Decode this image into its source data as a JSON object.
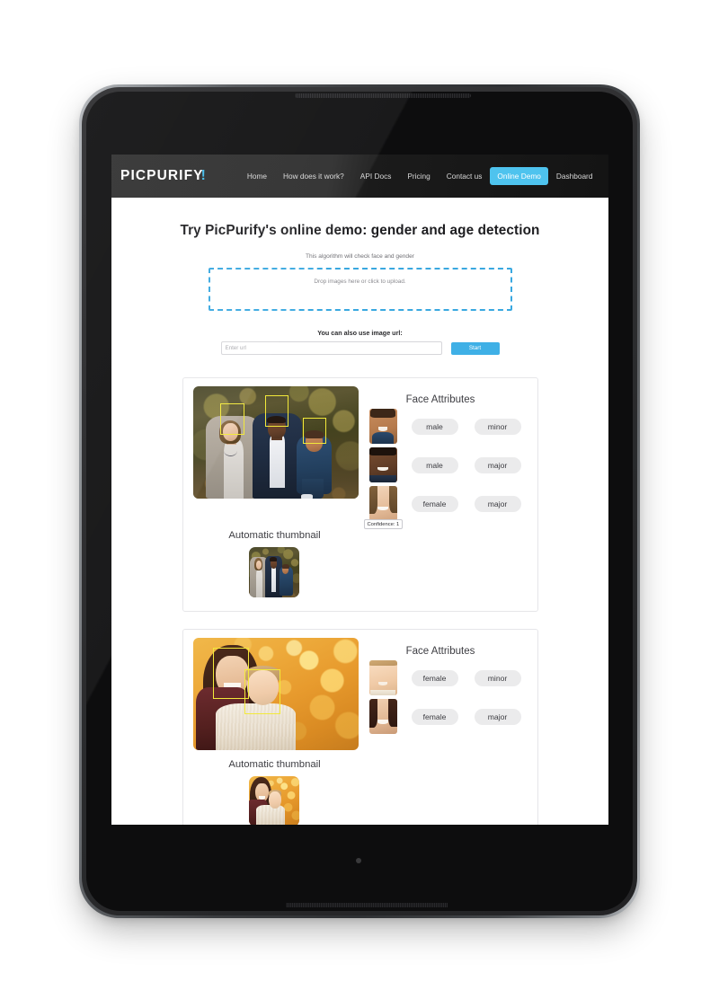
{
  "device": {
    "type": "tablet",
    "camera_icon": "front-camera-icon",
    "home_button_icon": "home-button-icon"
  },
  "nav": {
    "brand": "PICPURIFY",
    "brand_accent_glyph": "!",
    "accent_color": "#4ec3ee",
    "links": [
      {
        "label": "Home",
        "active": false
      },
      {
        "label": "How does it work?",
        "active": false
      },
      {
        "label": "API Docs",
        "active": false
      },
      {
        "label": "Pricing",
        "active": false
      },
      {
        "label": "Contact us",
        "active": false
      },
      {
        "label": "Online Demo",
        "active": true
      },
      {
        "label": "Dashboard",
        "active": false
      }
    ]
  },
  "page": {
    "title": "Try PicPurify's online demo: gender and age detection",
    "algorithm_note": "This algorithm will check face and gender",
    "dropzone_label": "Drop images here or click to upload.",
    "url_label": "You can also use image url:",
    "url_input_value": "",
    "url_input_placeholder": "Enter url",
    "start_button": "Start",
    "start_button_color": "#3fb0e6",
    "dropzone_border_color": "#39a8e0"
  },
  "results": [
    {
      "photo_name": "family-outdoor-photo",
      "face_boxes": 3,
      "attributes_title": "Face Attributes",
      "faces": [
        {
          "thumb_name": "face-thumb-child",
          "gender": "male",
          "age": "minor"
        },
        {
          "thumb_name": "face-thumb-man",
          "gender": "male",
          "age": "major"
        },
        {
          "thumb_name": "face-thumb-woman",
          "gender": "female",
          "age": "major",
          "tooltip": "Confidence: 1"
        }
      ],
      "thumbnail_title": "Automatic thumbnail"
    },
    {
      "photo_name": "mother-baby-autumn-photo",
      "face_boxes": 2,
      "attributes_title": "Face Attributes",
      "faces": [
        {
          "thumb_name": "face-thumb-baby",
          "gender": "female",
          "age": "minor"
        },
        {
          "thumb_name": "face-thumb-mother",
          "gender": "female",
          "age": "major"
        }
      ],
      "thumbnail_title": "Automatic thumbnail"
    }
  ],
  "pill_colors": {
    "background": "#ebebec",
    "text": "#3c3c41"
  },
  "face_box_color": "#f2e93a"
}
